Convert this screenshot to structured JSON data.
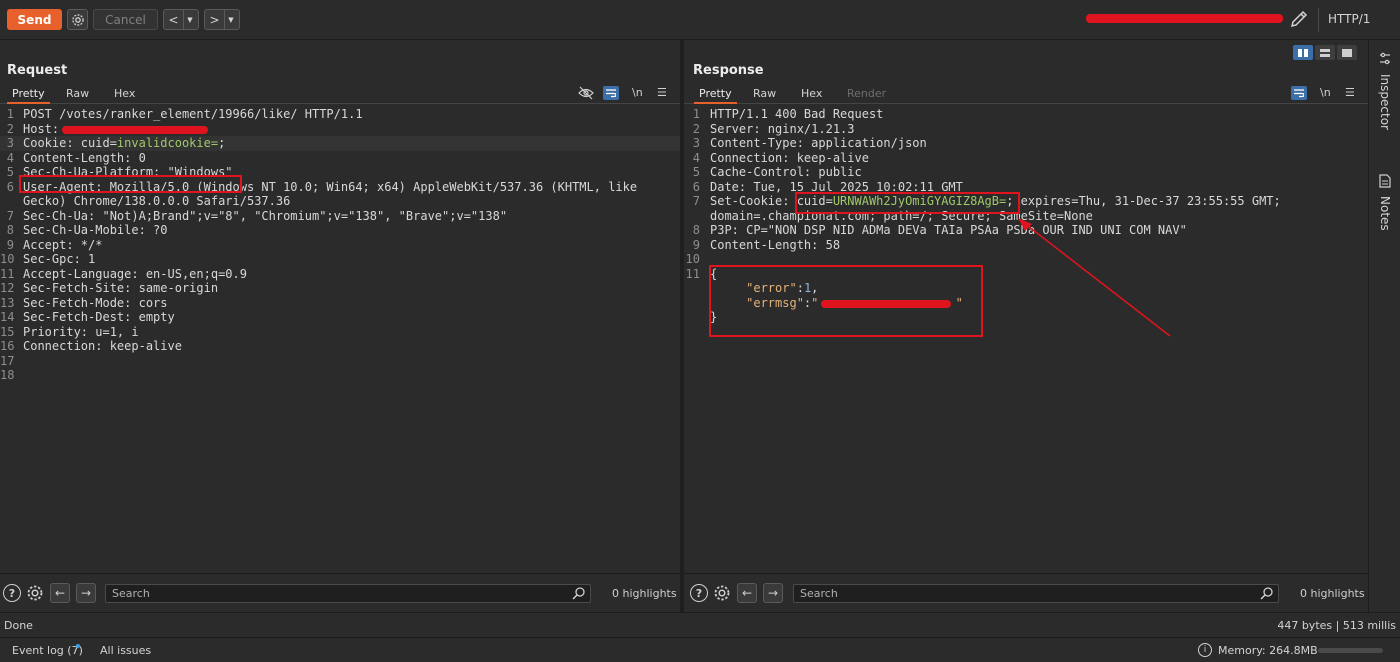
{
  "toolbar": {
    "send_label": "Send",
    "cancel_label": "Cancel",
    "back_label": "<",
    "forward_label": ">",
    "dropdown_glyph": "▼",
    "http_version": "HTTP/1"
  },
  "request": {
    "title": "Request",
    "tabs": [
      "Pretty",
      "Raw",
      "Hex"
    ],
    "lines": [
      {
        "n": "1",
        "parts": [
          {
            "t": "POST /votes/ranker_element/19966/like/ HTTP/1.1",
            "c": ""
          }
        ]
      },
      {
        "n": "2",
        "parts": [
          {
            "t": "Host: ",
            "c": ""
          }
        ]
      },
      {
        "n": "3",
        "parts": [
          {
            "t": "Cookie: cuid=",
            "c": ""
          },
          {
            "t": "invalidcookie=",
            "c": "grn"
          },
          {
            "t": ";",
            "c": ""
          }
        ]
      },
      {
        "n": "4",
        "parts": [
          {
            "t": "Content-Length: 0",
            "c": ""
          }
        ]
      },
      {
        "n": "5",
        "parts": [
          {
            "t": "Sec-Ch-Ua-Platform: \"Windows\"",
            "c": ""
          }
        ]
      },
      {
        "n": "6",
        "parts": [
          {
            "t": "User-Agent: Mozilla/5.0 (Windows NT 10.0; Win64; x64) AppleWebKit/537.36 (KHTML, like",
            "c": ""
          }
        ]
      },
      {
        "n": "",
        "parts": [
          {
            "t": "Gecko) Chrome/138.0.0.0 Safari/537.36",
            "c": ""
          }
        ]
      },
      {
        "n": "7",
        "parts": [
          {
            "t": "Sec-Ch-Ua: \"Not)A;Brand\";v=\"8\", \"Chromium\";v=\"138\", \"Brave\";v=\"138\"",
            "c": ""
          }
        ]
      },
      {
        "n": "8",
        "parts": [
          {
            "t": "Sec-Ch-Ua-Mobile: ?0",
            "c": ""
          }
        ]
      },
      {
        "n": "9",
        "parts": [
          {
            "t": "Accept: */*",
            "c": ""
          }
        ]
      },
      {
        "n": "10",
        "parts": [
          {
            "t": "Sec-Gpc: 1",
            "c": ""
          }
        ]
      },
      {
        "n": "11",
        "parts": [
          {
            "t": "Accept-Language: en-US,en;q=0.9",
            "c": ""
          }
        ]
      },
      {
        "n": "12",
        "parts": [
          {
            "t": "Sec-Fetch-Site: same-origin",
            "c": ""
          }
        ]
      },
      {
        "n": "13",
        "parts": [
          {
            "t": "Sec-Fetch-Mode: cors",
            "c": ""
          }
        ]
      },
      {
        "n": "14",
        "parts": [
          {
            "t": "Sec-Fetch-Dest: empty",
            "c": ""
          }
        ]
      },
      {
        "n": "15",
        "parts": [
          {
            "t": "Priority: u=1, i",
            "c": ""
          }
        ]
      },
      {
        "n": "16",
        "parts": [
          {
            "t": "Connection: keep-alive",
            "c": ""
          }
        ]
      },
      {
        "n": "17",
        "parts": [
          {
            "t": "",
            "c": ""
          }
        ]
      },
      {
        "n": "18",
        "parts": [
          {
            "t": "",
            "c": ""
          }
        ]
      }
    ],
    "search_placeholder": "Search",
    "highlights": "0 highlights"
  },
  "response": {
    "title": "Response",
    "tabs": [
      "Pretty",
      "Raw",
      "Hex",
      "Render"
    ],
    "lines": [
      {
        "n": "1",
        "parts": [
          {
            "t": "HTTP/1.1 400 Bad Request",
            "c": ""
          }
        ]
      },
      {
        "n": "2",
        "parts": [
          {
            "t": "Server: nginx/1.21.3",
            "c": ""
          }
        ]
      },
      {
        "n": "3",
        "parts": [
          {
            "t": "Content-Type: application/json",
            "c": ""
          }
        ]
      },
      {
        "n": "4",
        "parts": [
          {
            "t": "Connection: keep-alive",
            "c": ""
          }
        ]
      },
      {
        "n": "5",
        "parts": [
          {
            "t": "Cache-Control: public",
            "c": ""
          }
        ]
      },
      {
        "n": "6",
        "parts": [
          {
            "t": "Date: Tue, 15 Jul 2025 10:02:11 GMT",
            "c": ""
          }
        ]
      },
      {
        "n": "7",
        "parts": [
          {
            "t": "Set-Cookie: cuid=",
            "c": ""
          },
          {
            "t": "URNWAWh2JyOmiGYAGIZ8AgB=",
            "c": "grn"
          },
          {
            "t": "; expires=Thu, 31-Dec-37 23:55:55 GMT;",
            "c": ""
          }
        ]
      },
      {
        "n": "",
        "parts": [
          {
            "t": "domain=.championat.com; path=/; Secure; SameSite=None",
            "c": ""
          }
        ]
      },
      {
        "n": "8",
        "parts": [
          {
            "t": "P3P: CP=\"NON DSP NID ADMa DEVa TAIa PSAa PSDa OUR IND UNI COM NAV\"",
            "c": ""
          }
        ]
      },
      {
        "n": "9",
        "parts": [
          {
            "t": "Content-Length: 58",
            "c": ""
          }
        ]
      },
      {
        "n": "10",
        "parts": [
          {
            "t": "",
            "c": ""
          }
        ]
      },
      {
        "n": "11",
        "parts": [
          {
            "t": "{",
            "c": ""
          }
        ]
      },
      {
        "n": "",
        "parts": [
          {
            "t": "     ",
            "c": ""
          },
          {
            "t": "\"error\"",
            "c": "str"
          },
          {
            "t": ":",
            "c": ""
          },
          {
            "t": "1",
            "c": "num"
          },
          {
            "t": ",",
            "c": ""
          }
        ]
      },
      {
        "n": "",
        "parts": [
          {
            "t": "     ",
            "c": ""
          },
          {
            "t": "\"errmsg\"",
            "c": "str"
          },
          {
            "t": ":",
            "c": ""
          },
          {
            "t": "\"",
            "c": "str"
          },
          {
            "t": "                   ",
            "c": ""
          },
          {
            "t": "\"",
            "c": "str"
          }
        ]
      },
      {
        "n": "",
        "parts": [
          {
            "t": "}",
            "c": ""
          }
        ]
      }
    ],
    "search_placeholder": "Search",
    "highlights": "0 highlights"
  },
  "sidebar": {
    "inspector": "Inspector",
    "notes": "Notes"
  },
  "status": {
    "done": "Done",
    "bytes": "447 bytes | 513 millis",
    "event_log": "Event log (7)",
    "all_issues": "All issues",
    "memory": "Memory: 264.8MB",
    "memory_fraction": 0.0
  },
  "colors": {
    "accent": "#e8612c",
    "redaction": "#e0141e",
    "value_green": "#9fc96b",
    "json_string": "#e6b37a",
    "json_number": "#8cb4e0",
    "active_blue": "#3c6ea8"
  }
}
